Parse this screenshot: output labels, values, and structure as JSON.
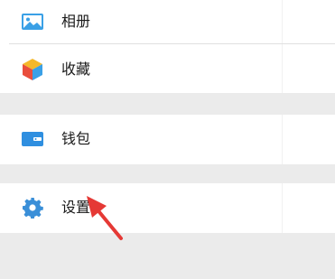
{
  "menu": {
    "items": [
      {
        "label": "相册",
        "icon": "photo-album-icon",
        "color": "#3aa0e6"
      },
      {
        "label": "收藏",
        "icon": "favorites-cube-icon",
        "color": "#f5b82a"
      },
      {
        "label": "钱包",
        "icon": "wallet-icon",
        "color": "#2f8fe0"
      },
      {
        "label": "设置",
        "icon": "gear-icon",
        "color": "#3a8fd8"
      }
    ]
  },
  "colors": {
    "background": "#ebebeb",
    "item_background": "#ffffff",
    "annotation_arrow": "#e53935"
  }
}
